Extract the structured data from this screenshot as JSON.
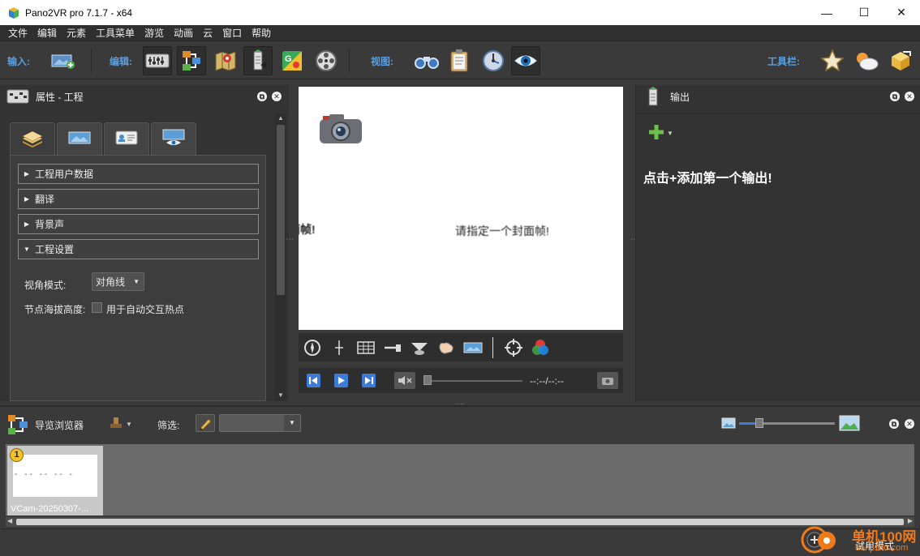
{
  "window": {
    "title": "Pano2VR pro 7.1.7 - x64",
    "minimize": "—",
    "maximize": "☐",
    "close": "✕"
  },
  "menu": [
    "文件",
    "编辑",
    "元素",
    "工具菜单",
    "游览",
    "动画",
    "云",
    "窗口",
    "帮助"
  ],
  "toolbar": {
    "input_label": "输入:",
    "edit_label": "编辑:",
    "view_label": "视图:",
    "toolbar_label": "工具栏:"
  },
  "properties": {
    "title": "属性 - 工程",
    "sections": [
      "工程用户数据",
      "翻译",
      "背景声",
      "工程设置"
    ],
    "fov_mode_label": "视角模式:",
    "fov_mode_value": "对角线",
    "node_altitude_label": "节点海拔高度:",
    "auto_hotspot_label": "用于自动交互热点"
  },
  "viewer": {
    "partial_text": "面帧!",
    "center_text": "请指定一个封面帧!",
    "time": "--:--/--:--"
  },
  "output": {
    "title": "输出",
    "hint": "点击+添加第一个输出!"
  },
  "navigator": {
    "title": "导览浏览器",
    "filter_label": "筛选:",
    "filter_value": "",
    "thumb_badge": "1",
    "thumb_label": "VCam-20250307-..."
  },
  "status": {
    "trial_mode": "试用模式"
  },
  "watermark": {
    "brand": "单机100网",
    "url": "danji100.com"
  },
  "colors": {
    "accent_label": "#5a9fe0",
    "panel_bg": "#333333",
    "window_bg": "#3a3a3a"
  }
}
